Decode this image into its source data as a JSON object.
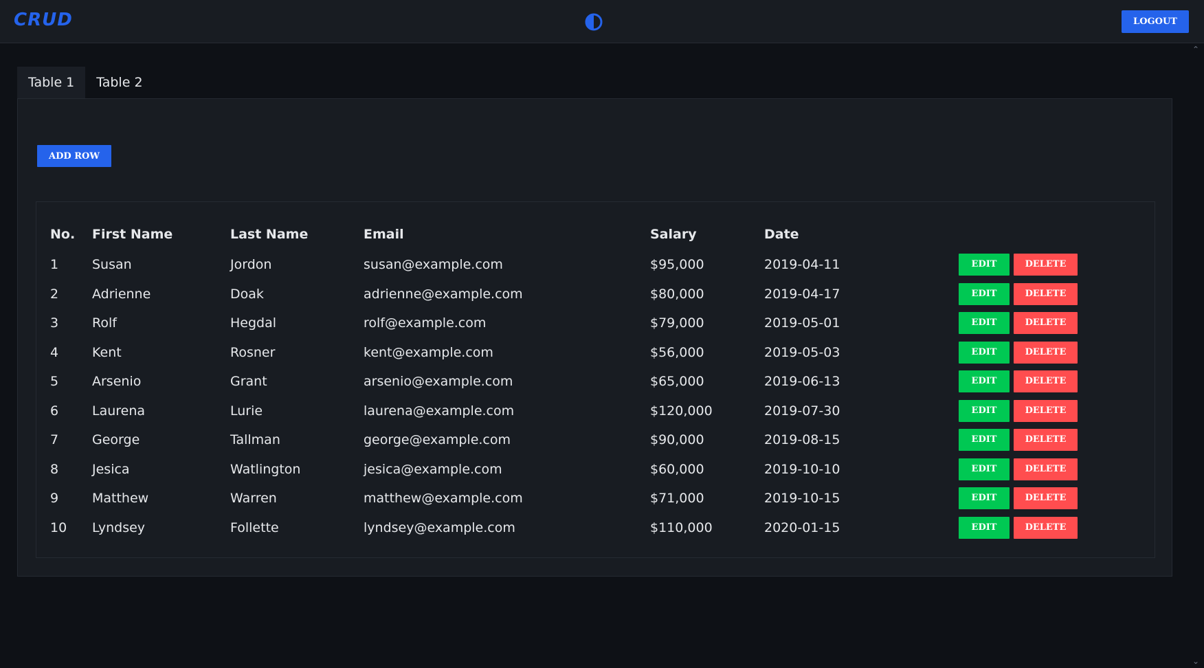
{
  "app": {
    "title": "CRUD",
    "logout_label": "LOGOUT"
  },
  "icons": {
    "theme": "half-circle-contrast-icon",
    "scroll_up": "chevron-up-icon",
    "scroll_down": "chevron-down-icon"
  },
  "tabs": [
    {
      "label": "Table 1",
      "active": true
    },
    {
      "label": "Table 2",
      "active": false
    }
  ],
  "toolbar": {
    "add_row_label": "ADD ROW"
  },
  "table": {
    "columns": [
      "No.",
      "First Name",
      "Last Name",
      "Email",
      "Salary",
      "Date"
    ],
    "edit_label": "EDIT",
    "delete_label": "DELETE",
    "rows": [
      {
        "no": "1",
        "first": "Susan",
        "last": "Jordon",
        "email": "susan@example.com",
        "salary": "$95,000",
        "date": "2019-04-11"
      },
      {
        "no": "2",
        "first": "Adrienne",
        "last": "Doak",
        "email": "adrienne@example.com",
        "salary": "$80,000",
        "date": "2019-04-17"
      },
      {
        "no": "3",
        "first": "Rolf",
        "last": "Hegdal",
        "email": "rolf@example.com",
        "salary": "$79,000",
        "date": "2019-05-01"
      },
      {
        "no": "4",
        "first": "Kent",
        "last": "Rosner",
        "email": "kent@example.com",
        "salary": "$56,000",
        "date": "2019-05-03"
      },
      {
        "no": "5",
        "first": "Arsenio",
        "last": "Grant",
        "email": "arsenio@example.com",
        "salary": "$65,000",
        "date": "2019-06-13"
      },
      {
        "no": "6",
        "first": "Laurena",
        "last": "Lurie",
        "email": "laurena@example.com",
        "salary": "$120,000",
        "date": "2019-07-30"
      },
      {
        "no": "7",
        "first": "George",
        "last": "Tallman",
        "email": "george@example.com",
        "salary": "$90,000",
        "date": "2019-08-15"
      },
      {
        "no": "8",
        "first": "Jesica",
        "last": "Watlington",
        "email": "jesica@example.com",
        "salary": "$60,000",
        "date": "2019-10-10"
      },
      {
        "no": "9",
        "first": "Matthew",
        "last": "Warren",
        "email": "matthew@example.com",
        "salary": "$71,000",
        "date": "2019-10-15"
      },
      {
        "no": "10",
        "first": "Lyndsey",
        "last": "Follette",
        "email": "lyndsey@example.com",
        "salary": "$110,000",
        "date": "2020-01-15"
      }
    ]
  },
  "colors": {
    "brand": "#2563eb",
    "primary_button": "#2563eb",
    "edit_button": "#00c853",
    "delete_button": "#ff4d4f"
  }
}
